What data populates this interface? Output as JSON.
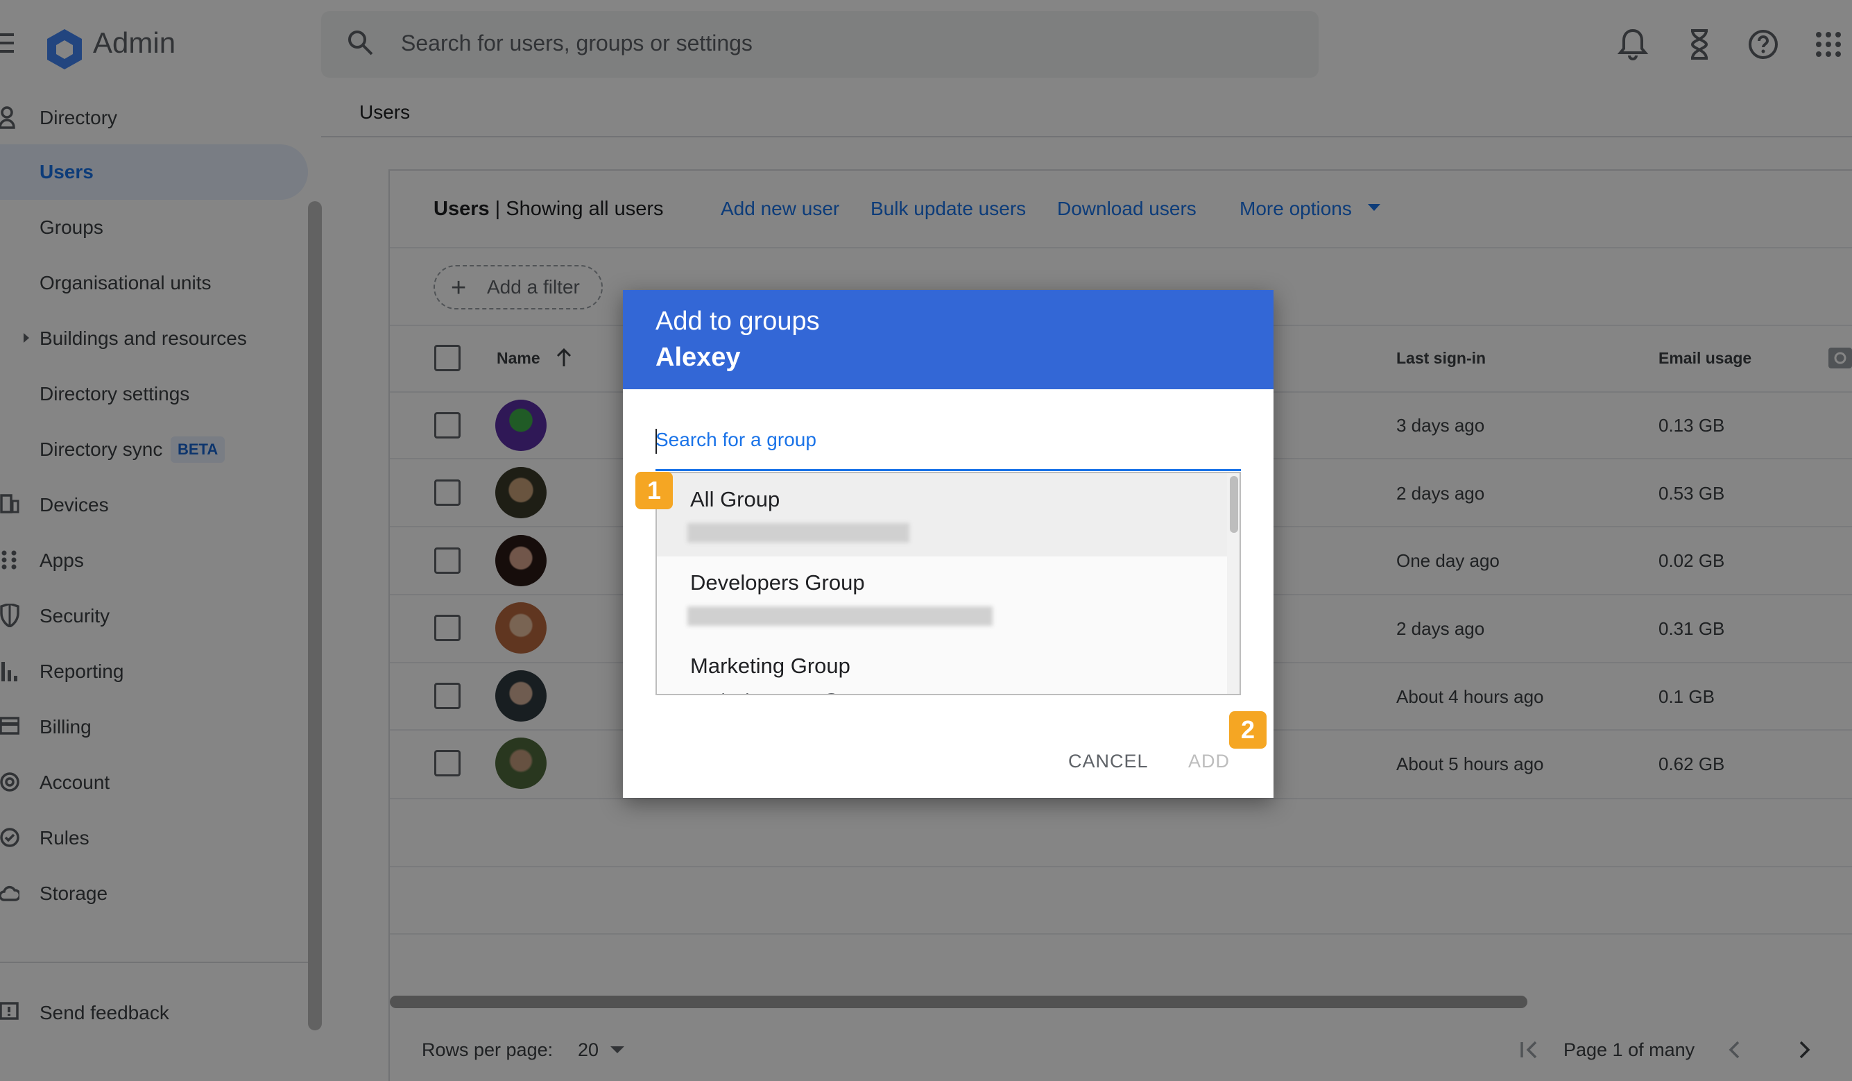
{
  "header": {
    "app_title": "Admin",
    "search_placeholder": "Search for users, groups or settings"
  },
  "sidebar": {
    "items": [
      {
        "label": "Directory",
        "icon": "person-icon"
      },
      {
        "label": "Users",
        "icon": "",
        "active": true
      },
      {
        "label": "Groups",
        "icon": ""
      },
      {
        "label": "Organisational units",
        "icon": ""
      },
      {
        "label": "Buildings and resources",
        "icon": "triangle-right-icon"
      },
      {
        "label": "Directory settings",
        "icon": ""
      },
      {
        "label": "Directory sync",
        "icon": "",
        "badge": "BETA"
      },
      {
        "label": "Devices",
        "icon": "devices-icon"
      },
      {
        "label": "Apps",
        "icon": "apps-icon"
      },
      {
        "label": "Security",
        "icon": "shield-icon"
      },
      {
        "label": "Reporting",
        "icon": "bar-chart-icon"
      },
      {
        "label": "Billing",
        "icon": "credit-card-icon"
      },
      {
        "label": "Account",
        "icon": "at-icon"
      },
      {
        "label": "Rules",
        "icon": "rules-icon"
      },
      {
        "label": "Storage",
        "icon": "cloud-icon"
      }
    ],
    "feedback": "Send feedback"
  },
  "breadcrumb": "Users",
  "card": {
    "title_bold": "Users",
    "title_rest": " | Showing all users",
    "links": [
      "Add new user",
      "Bulk update users",
      "Download users",
      "More options"
    ],
    "filter_label": "Add a filter"
  },
  "table": {
    "headers": {
      "name": "Name",
      "last_signin": "Last sign-in",
      "email_usage": "Email usage"
    },
    "rows": [
      {
        "last_signin": "3 days ago",
        "email_usage": "0.13 GB"
      },
      {
        "last_signin": "2 days ago",
        "email_usage": "0.53 GB"
      },
      {
        "last_signin": "One day ago",
        "email_usage": "0.02 GB"
      },
      {
        "last_signin": "2 days ago",
        "email_usage": "0.31 GB"
      },
      {
        "last_signin": "About 4 hours ago",
        "email_usage": "0.1 GB"
      },
      {
        "last_signin": "About 5 hours ago",
        "email_usage": "0.62 GB"
      }
    ]
  },
  "footer": {
    "rows_per_page_label": "Rows per page:",
    "rows_per_page_value": "20",
    "page_label": "Page 1 of many"
  },
  "dialog": {
    "title": "Add to groups",
    "subtitle": "Alexey",
    "search_placeholder": "Search for a group",
    "groups": [
      {
        "name": "All Group"
      },
      {
        "name": "Developers Group"
      },
      {
        "name": "Marketing Group",
        "email": "marketing-group@gantt-pro.com"
      }
    ],
    "cancel_label": "CANCEL",
    "add_label": "ADD"
  },
  "annotations": [
    "1",
    "2"
  ],
  "colors": {
    "accent": "#1a73e8",
    "dialog_header": "#3367d6",
    "badge": "#f5a623"
  }
}
